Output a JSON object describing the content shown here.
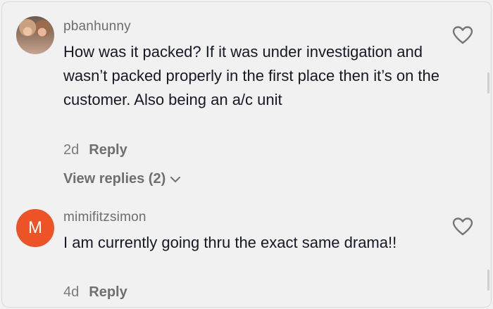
{
  "comments": [
    {
      "username": "pbanhunny",
      "text": "How was it packed? If it was under investigation and wasn’t packed properly in the first place then it’s on the customer. Also being an a/c unit",
      "time": "2d",
      "reply_label": "Reply",
      "view_replies_label": "View replies (2)",
      "avatar_icon": "profile-photo"
    },
    {
      "username": "mimifitzsimon",
      "avatar_letter": "M",
      "text": "I am currently going thru the exact same drama!!",
      "time": "4d",
      "reply_label": "Reply"
    }
  ],
  "colors": {
    "background": "#f1f1f2",
    "avatar_orange": "#ec5427",
    "text": "#161823",
    "muted": "#7b7b7e"
  },
  "icons": [
    "heart-outline-icon",
    "chevron-down-icon"
  ]
}
